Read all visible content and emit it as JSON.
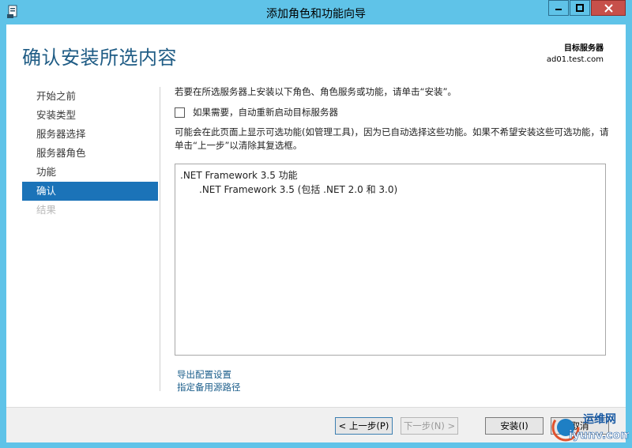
{
  "window": {
    "title": "添加角色和功能向导",
    "controls": {
      "minimize": "▬",
      "maximize": "□",
      "close": "✕"
    }
  },
  "header": {
    "page_title": "确认安装所选内容",
    "target_label": "目标服务器",
    "target_value": "ad01.test.com"
  },
  "nav": {
    "items": [
      {
        "label": "开始之前",
        "state": "normal"
      },
      {
        "label": "安装类型",
        "state": "normal"
      },
      {
        "label": "服务器选择",
        "state": "normal"
      },
      {
        "label": "服务器角色",
        "state": "normal"
      },
      {
        "label": "功能",
        "state": "normal"
      },
      {
        "label": "确认",
        "state": "active"
      },
      {
        "label": "结果",
        "state": "disabled"
      }
    ]
  },
  "content": {
    "intro": "若要在所选服务器上安装以下角色、角色服务或功能，请单击“安装”。",
    "restart_checkbox_label": "如果需要，自动重新启动目标服务器",
    "restart_checked": false,
    "note": "可能会在此页面上显示可选功能(如管理工具)，因为已自动选择这些功能。如果不希望安装这些可选功能，请单击“上一步”以清除其复选框。",
    "selection": [
      ".NET Framework 3.5 功能",
      ".NET Framework 3.5 (包括 .NET 2.0 和 3.0)"
    ],
    "links": {
      "export": "导出配置设置",
      "alt_source": "指定备用源路径"
    }
  },
  "footer": {
    "prev": "< 上一步(P)",
    "next": "下一步(N) >",
    "install": "安装(I)",
    "cancel": "取消"
  },
  "watermark": {
    "line1": "运维网",
    "line2": "iyunv.com"
  },
  "colors": {
    "frame": "#5fc3e8",
    "accent": "#1b73b8",
    "title": "#1f5c85",
    "close": "#c7504a"
  }
}
